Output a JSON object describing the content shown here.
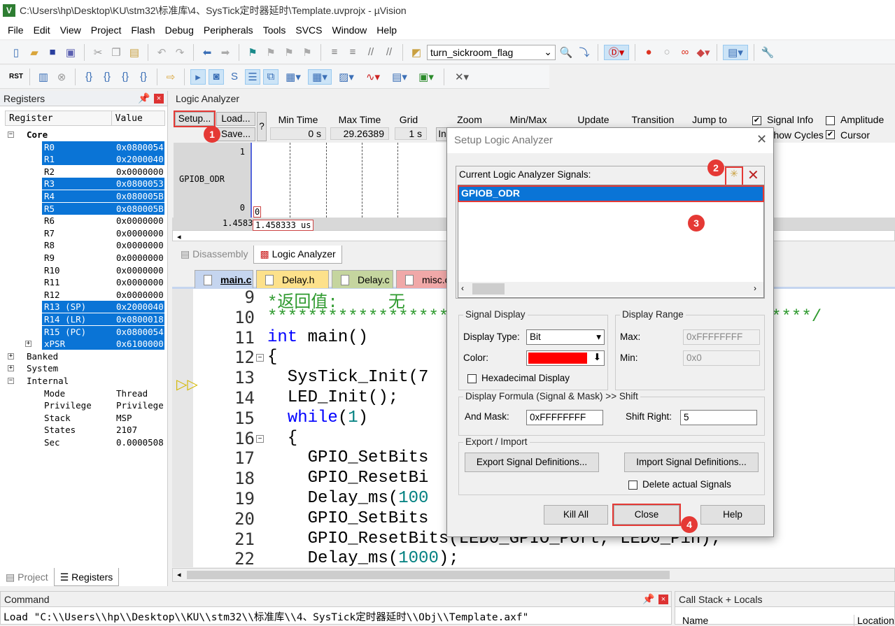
{
  "window": {
    "title": "C:\\Users\\hp\\Desktop\\KU\\stm32\\标准库\\4、SysTick定时器延时\\Template.uvprojx - µVision"
  },
  "menu": [
    "File",
    "Edit",
    "View",
    "Project",
    "Flash",
    "Debug",
    "Peripherals",
    "Tools",
    "SVCS",
    "Window",
    "Help"
  ],
  "toolbar": {
    "find_value": "turn_sickroom_flag"
  },
  "registers": {
    "title": "Registers",
    "col_register": "Register",
    "col_value": "Value",
    "core": "Core",
    "rows": [
      {
        "name": "R0",
        "value": "0x0800054",
        "sel": true
      },
      {
        "name": "R1",
        "value": "0x2000040",
        "sel": true
      },
      {
        "name": "R2",
        "value": "0x0000000",
        "sel": false
      },
      {
        "name": "R3",
        "value": "0x0800053",
        "sel": true
      },
      {
        "name": "R4",
        "value": "0x080005B",
        "sel": true
      },
      {
        "name": "R5",
        "value": "0x080005B",
        "sel": true
      },
      {
        "name": "R6",
        "value": "0x0000000",
        "sel": false
      },
      {
        "name": "R7",
        "value": "0x0000000",
        "sel": false
      },
      {
        "name": "R8",
        "value": "0x0000000",
        "sel": false
      },
      {
        "name": "R9",
        "value": "0x0000000",
        "sel": false
      },
      {
        "name": "R10",
        "value": "0x0000000",
        "sel": false
      },
      {
        "name": "R11",
        "value": "0x0000000",
        "sel": false
      },
      {
        "name": "R12",
        "value": "0x0000000",
        "sel": false
      },
      {
        "name": "R13 (SP)",
        "value": "0x2000040",
        "sel": true
      },
      {
        "name": "R14 (LR)",
        "value": "0x0800018",
        "sel": true
      },
      {
        "name": "R15 (PC)",
        "value": "0x0800054",
        "sel": true
      },
      {
        "name": "xPSR",
        "value": "0x6100000",
        "sel": true
      }
    ],
    "groups": [
      "Banked",
      "System",
      "Internal"
    ],
    "internal": [
      {
        "name": "Mode",
        "value": "Thread"
      },
      {
        "name": "Privilege",
        "value": "Privilege"
      },
      {
        "name": "Stack",
        "value": "MSP"
      },
      {
        "name": "States",
        "value": "2107"
      },
      {
        "name": "Sec",
        "value": "0.0000508"
      }
    ],
    "tab_project": "Project",
    "tab_registers": "Registers"
  },
  "logic_analyzer": {
    "title": "Logic Analyzer",
    "setup": "Setup...",
    "load": "Load...",
    "save": "Save...",
    "help": "?",
    "min_time_label": "Min Time",
    "min_time": "0 s",
    "max_time_label": "Max Time",
    "max_time": "29.26389 us",
    "grid_label": "Grid",
    "grid": "1 s",
    "zoom_label": "Zoom",
    "zoom_in": "In",
    "minmax_label": "Min/Max",
    "update_label": "Update Screen",
    "transition_label": "Transition",
    "jump_label": "Jump to",
    "signal_info": "Signal Info",
    "amplitude": "Amplitude",
    "show_cycles": "Show Cycles",
    "cursor": "Cursor",
    "signal_info_checked": true,
    "amplitude_checked": false,
    "cursor_checked": true,
    "signal": "GPIOB_ODR",
    "y_high": "1",
    "y_low": "0",
    "cursor_value": "0",
    "time_left": "1.45833",
    "cursor_time": "1.458333 us"
  },
  "bottom_tabs": {
    "disassembly": "Disassembly",
    "logic_analyzer": "Logic Analyzer"
  },
  "editor_tabs": [
    {
      "label": "main.c",
      "color": "#c5d5ef"
    },
    {
      "label": "Delay.h",
      "color": "#fde18b"
    },
    {
      "label": "Delay.c",
      "color": "#c5d59f"
    },
    {
      "label": "misc.c",
      "color": "#f0a8a8"
    }
  ],
  "code": [
    {
      "n": "9",
      "html": "<span class='cm'>*返回值:     无</span>"
    },
    {
      "n": "10",
      "html": "<span class='cm'>******************************************************/</span>"
    },
    {
      "n": "11",
      "html": "<span class='kw'>int</span> main()"
    },
    {
      "n": "12",
      "html": "{"
    },
    {
      "n": "13",
      "html": "  SysTick_Init(7"
    },
    {
      "n": "14",
      "html": "  LED_Init();"
    },
    {
      "n": "15",
      "html": "  <span class='kw'>while</span>(<span class='num'>1</span>)"
    },
    {
      "n": "16",
      "html": "  {"
    },
    {
      "n": "17",
      "html": "    GPIO_SetBits"
    },
    {
      "n": "18",
      "html": "    GPIO_ResetBi"
    },
    {
      "n": "19",
      "html": "    Delay_ms(<span class='num'>100</span>"
    },
    {
      "n": "20",
      "html": "    GPIO_SetBits"
    },
    {
      "n": "21",
      "html": "    GPIO_ResetBits(LED0_GPIO_Port, LED0_Pin);"
    },
    {
      "n": "22",
      "html": "    Delay_ms(<span class='num'>1000</span>);"
    }
  ],
  "command": {
    "title": "Command",
    "text": "Load \"C:\\\\Users\\\\hp\\\\Desktop\\\\KU\\\\stm32\\\\标准库\\\\4、SysTick定时器延时\\\\Obj\\\\Template.axf\""
  },
  "callstack": {
    "title": "Call Stack + Locals",
    "col_name": "Name",
    "col_location": "Location"
  },
  "dialog": {
    "title": "Setup Logic Analyzer",
    "signals_label": "Current Logic Analyzer Signals:",
    "signals": [
      "GPIOB_ODR"
    ],
    "signal_display": "Signal Display",
    "display_type_label": "Display Type:",
    "display_type": "Bit",
    "color_label": "Color:",
    "color": "#ff0000",
    "hex_display": "Hexadecimal Display",
    "display_range": "Display Range",
    "max_label": "Max:",
    "max": "0xFFFFFFFF",
    "min_label": "Min:",
    "min": "0x0",
    "formula": "Display Formula (Signal & Mask) >> Shift",
    "and_mask_label": "And Mask:",
    "and_mask": "0xFFFFFFFF",
    "shift_label": "Shift Right:",
    "shift": "5",
    "export_import": "Export / Import",
    "export_btn": "Export Signal Definitions...",
    "import_btn": "Import Signal Definitions...",
    "delete_actual": "Delete actual Signals",
    "kill_all": "Kill All",
    "close": "Close",
    "help": "Help"
  },
  "annotations": [
    "1",
    "2",
    "3",
    "4"
  ]
}
